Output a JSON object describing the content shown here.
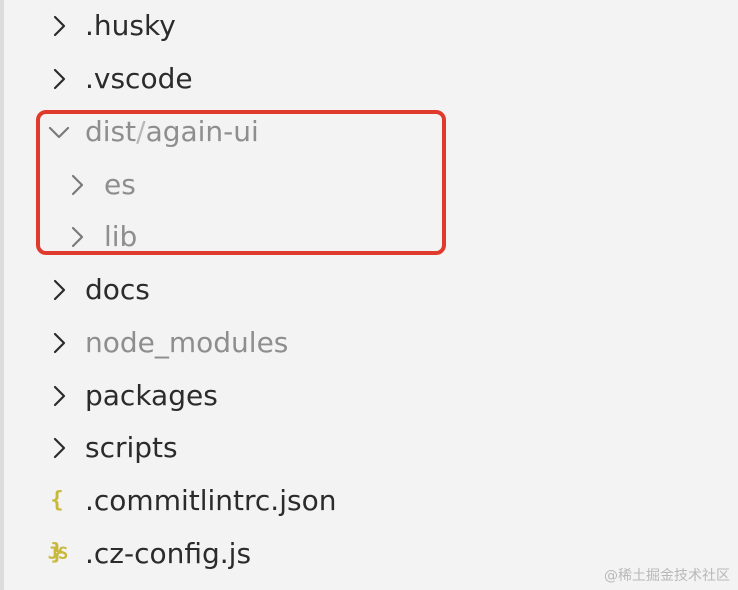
{
  "explorer": {
    "items": [
      {
        "name": "husky",
        "label": ".husky",
        "type": "folder",
        "expanded": false,
        "muted": false
      },
      {
        "name": "vscode",
        "label": ".vscode",
        "type": "folder",
        "expanded": false,
        "muted": false
      },
      {
        "name": "dist",
        "label": "dist",
        "sublabel": "again-ui",
        "separator": "/",
        "type": "folder",
        "expanded": true,
        "muted": true
      },
      {
        "name": "es",
        "label": "es",
        "type": "folder",
        "expanded": false,
        "muted": true
      },
      {
        "name": "lib",
        "label": "lib",
        "type": "folder",
        "expanded": false,
        "muted": true
      },
      {
        "name": "docs",
        "label": "docs",
        "type": "folder",
        "expanded": false,
        "muted": false
      },
      {
        "name": "node-modules",
        "label": "node_modules",
        "type": "folder",
        "expanded": false,
        "muted": true
      },
      {
        "name": "packages",
        "label": "packages",
        "type": "folder",
        "expanded": false,
        "muted": false
      },
      {
        "name": "scripts",
        "label": "scripts",
        "type": "folder",
        "expanded": false,
        "muted": false
      },
      {
        "name": "commitlintrc",
        "label": ".commitlintrc.json",
        "type": "file",
        "icon": "json-braces-icon",
        "icon_text": "{ }",
        "muted": false
      },
      {
        "name": "cz-config",
        "label": ".cz-config.js",
        "type": "file",
        "icon": "js-file-icon",
        "icon_text": "JS",
        "muted": false
      }
    ]
  },
  "watermark": "@稀土掘金技术社区",
  "colors": {
    "background": "#f3f3f3",
    "highlight": "#e03a2c",
    "text": "#2b2b2b",
    "muted_text": "#8e8e8e",
    "file_icon": "#c8b93a"
  }
}
